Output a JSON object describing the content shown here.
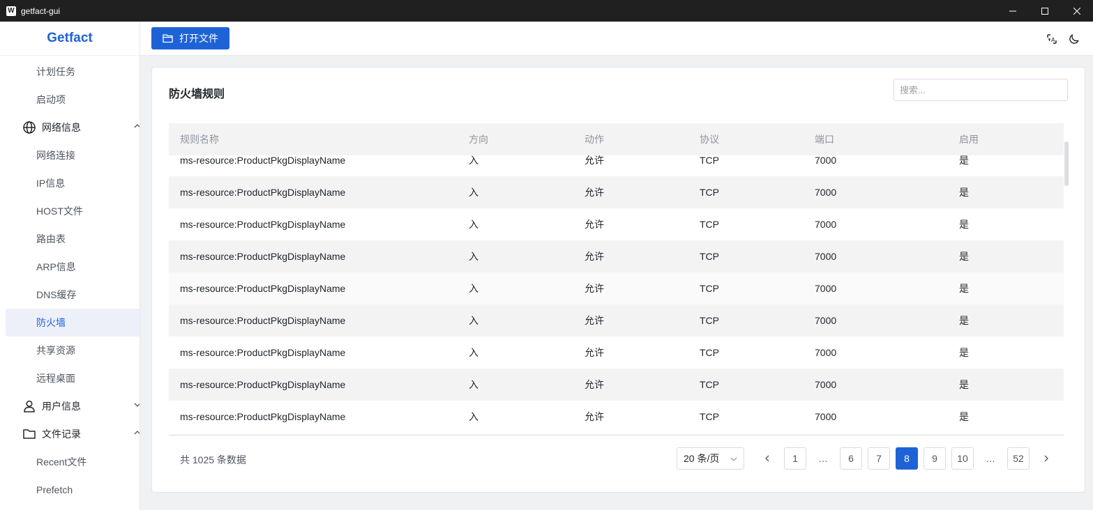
{
  "window": {
    "title": "getfact-gui",
    "app_icon": "W"
  },
  "sidebar": {
    "logo": "Getfact",
    "items": [
      {
        "label": "计划任务",
        "type": "item"
      },
      {
        "label": "启动项",
        "type": "item"
      },
      {
        "label": "网络信息",
        "type": "group",
        "icon": "globe-icon",
        "expanded": true
      },
      {
        "label": "网络连接",
        "type": "item"
      },
      {
        "label": "IP信息",
        "type": "item"
      },
      {
        "label": "HOST文件",
        "type": "item"
      },
      {
        "label": "路由表",
        "type": "item"
      },
      {
        "label": "ARP信息",
        "type": "item"
      },
      {
        "label": "DNS缓存",
        "type": "item"
      },
      {
        "label": "防火墙",
        "type": "item",
        "active": true
      },
      {
        "label": "共享资源",
        "type": "item"
      },
      {
        "label": "远程桌面",
        "type": "item"
      },
      {
        "label": "用户信息",
        "type": "group",
        "icon": "user-icon",
        "expanded": false
      },
      {
        "label": "文件记录",
        "type": "group",
        "icon": "folder-icon",
        "expanded": true
      },
      {
        "label": "Recent文件",
        "type": "item"
      },
      {
        "label": "Prefetch",
        "type": "item"
      }
    ]
  },
  "toolbar": {
    "open_label": "打开文件"
  },
  "card": {
    "title": "防火墙规则",
    "search_placeholder": "搜索...",
    "columns": [
      "规则名称",
      "方向",
      "动作",
      "协议",
      "端口",
      "启用"
    ],
    "rows": [
      [
        "ms-resource:ProductPkgDisplayName",
        "入",
        "允许",
        "TCP",
        "7000",
        "是"
      ],
      [
        "ms-resource:ProductPkgDisplayName",
        "入",
        "允许",
        "TCP",
        "7000",
        "是"
      ],
      [
        "ms-resource:ProductPkgDisplayName",
        "入",
        "允许",
        "TCP",
        "7000",
        "是"
      ],
      [
        "ms-resource:ProductPkgDisplayName",
        "入",
        "允许",
        "TCP",
        "7000",
        "是"
      ],
      [
        "ms-resource:ProductPkgDisplayName",
        "入",
        "允许",
        "TCP",
        "7000",
        "是"
      ],
      [
        "ms-resource:ProductPkgDisplayName",
        "入",
        "允许",
        "TCP",
        "7000",
        "是"
      ],
      [
        "ms-resource:ProductPkgDisplayName",
        "入",
        "允许",
        "TCP",
        "7000",
        "是"
      ],
      [
        "ms-resource:ProductPkgDisplayName",
        "入",
        "允许",
        "TCP",
        "7000",
        "是"
      ],
      [
        "ms-resource:ProductPkgDisplayName",
        "入",
        "允许",
        "TCP",
        "7000",
        "是"
      ]
    ]
  },
  "pagination": {
    "total_text": "共 1025 条数据",
    "page_size": "20 条/页",
    "pages": [
      "1",
      "…",
      "6",
      "7",
      "8",
      "9",
      "10",
      "…",
      "52"
    ],
    "current": "8"
  },
  "colors": {
    "accent": "#1d63d6"
  }
}
